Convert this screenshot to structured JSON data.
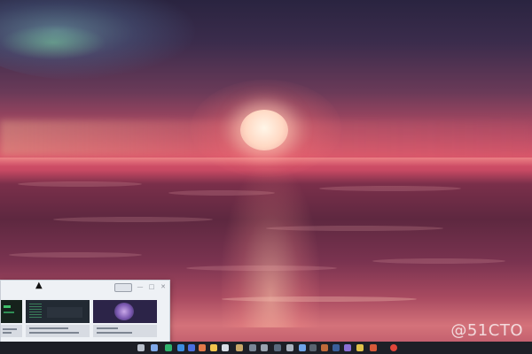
{
  "watermark": {
    "text": "@51CTO"
  },
  "taskbar": {
    "icons": [
      {
        "name": "search-icon",
        "color": "#b9c0cc"
      },
      {
        "name": "chat-icon",
        "color": "#7fa8e8"
      },
      {
        "name": "browser-icon",
        "color": "#2fb36d"
      },
      {
        "name": "edge-icon",
        "color": "#3d8de0"
      },
      {
        "name": "store-icon",
        "color": "#4a6fe0"
      },
      {
        "name": "photos-icon",
        "color": "#e27a4a"
      },
      {
        "name": "file-explorer-icon",
        "color": "#f2c44d"
      },
      {
        "name": "terminal-icon",
        "color": "#d8dde5"
      },
      {
        "name": "mail-icon",
        "color": "#c9a86a"
      },
      {
        "name": "music-icon",
        "color": "#7a8696"
      },
      {
        "name": "settings-icon",
        "color": "#9aa3af"
      },
      {
        "name": "camera-icon",
        "color": "#5a6a7d"
      },
      {
        "name": "calculator-icon",
        "color": "#aab2be"
      },
      {
        "name": "notepad-icon",
        "color": "#6fa3e8"
      },
      {
        "name": "app-icon-a",
        "color": "#5a6470"
      },
      {
        "name": "app-icon-b",
        "color": "#c06a3a"
      },
      {
        "name": "app-icon-c",
        "color": "#3a5f9a"
      },
      {
        "name": "app-icon-d",
        "color": "#8a6fd4"
      },
      {
        "name": "app-icon-e",
        "color": "#e0c24a"
      },
      {
        "name": "app-icon-f",
        "color": "#d85a3a"
      },
      {
        "name": "app-icon-g",
        "color": "#e0463a"
      }
    ]
  },
  "switcher": {
    "thumbnails": [
      {
        "name": "window-thumb-terminal",
        "color": "#16221c"
      },
      {
        "name": "window-thumb-desktop",
        "color": "#222a33"
      },
      {
        "name": "window-thumb-wallpaper",
        "color": "#2c2448"
      }
    ]
  }
}
